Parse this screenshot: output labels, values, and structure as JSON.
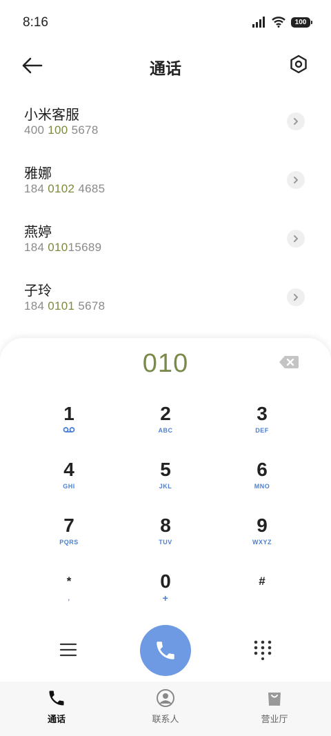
{
  "status_bar": {
    "time": "8:16",
    "battery": "100"
  },
  "header": {
    "title": "通话"
  },
  "contacts": [
    {
      "name": "小米客服",
      "number_before": "400 ",
      "number_highlight": "100",
      "number_after": " 5678"
    },
    {
      "name": "雅娜",
      "number_before": "184 ",
      "number_highlight": "0102",
      "number_after": " 4685"
    },
    {
      "name": "燕婷",
      "number_before": "184 ",
      "number_highlight": "010",
      "number_after": "15689"
    },
    {
      "name": "子玲",
      "number_before": "184 ",
      "number_highlight": "0101",
      "number_after": " 5678"
    }
  ],
  "dialpad": {
    "dialed": "010",
    "keys": [
      {
        "digit": "1",
        "letters": ""
      },
      {
        "digit": "2",
        "letters": "ABC"
      },
      {
        "digit": "3",
        "letters": "DEF"
      },
      {
        "digit": "4",
        "letters": "GHI"
      },
      {
        "digit": "5",
        "letters": "JKL"
      },
      {
        "digit": "6",
        "letters": "MNO"
      },
      {
        "digit": "7",
        "letters": "PQRS"
      },
      {
        "digit": "8",
        "letters": "TUV"
      },
      {
        "digit": "9",
        "letters": "WXYZ"
      },
      {
        "digit": "*",
        "letters": ","
      },
      {
        "digit": "0",
        "letters": "+"
      },
      {
        "digit": "#",
        "letters": ""
      }
    ]
  },
  "bottom_nav": [
    {
      "label": "通话",
      "icon": "phone-icon",
      "active": true
    },
    {
      "label": "联系人",
      "icon": "person-icon",
      "active": false
    },
    {
      "label": "营业厅",
      "icon": "shopping-bag-icon",
      "active": false
    }
  ],
  "colors": {
    "accent": "#6d9ae3",
    "highlight_number": "#7a8a3e",
    "key_letters": "#4a7fd6"
  }
}
